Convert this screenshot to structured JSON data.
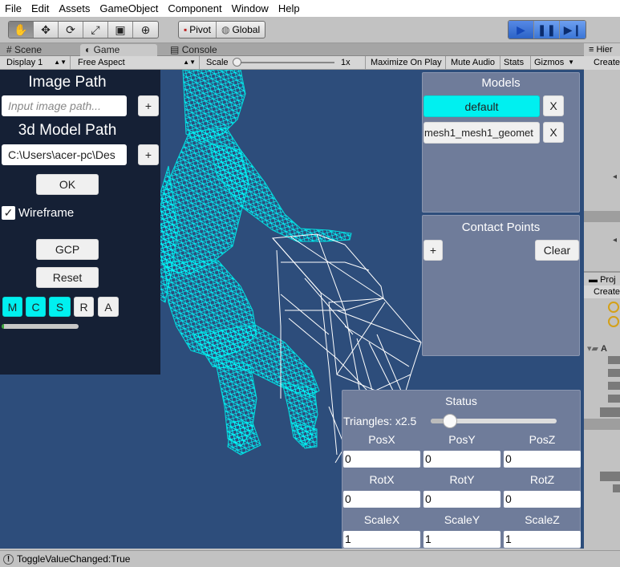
{
  "menu": [
    "File",
    "Edit",
    "Assets",
    "GameObject",
    "Component",
    "Window",
    "Help"
  ],
  "toolbar": {
    "tools": [
      "hand-icon",
      "move-icon",
      "rotate-icon",
      "scale-icon",
      "rect-icon",
      "transform-icon"
    ],
    "pivot_label": "Pivot",
    "global_label": "Global"
  },
  "tabs": [
    "Scene",
    "Game",
    "Console"
  ],
  "gamebar": {
    "display": "Display 1",
    "aspect": "Free Aspect",
    "scale_label": "Scale",
    "scale_value": "1x",
    "maximize": "Maximize On Play",
    "mute": "Mute Audio",
    "stats": "Stats",
    "gizmos": "Gizmos"
  },
  "hierarchy": {
    "tab": "Hier",
    "create": "Create"
  },
  "project": {
    "tab": "Proj",
    "create": "Create",
    "folder": "A"
  },
  "left_panel": {
    "image_title": "Image Path",
    "image_placeholder": "Input image path...",
    "model_title": "3d Model Path",
    "model_value": "C:\\Users\\acer-pc\\Des",
    "add_label": "+",
    "ok_label": "OK",
    "wireframe_label": "Wireframe",
    "wireframe_checked": "✓",
    "gcp_label": "GCP",
    "reset_label": "Reset",
    "mode_buttons": [
      "M",
      "C",
      "S",
      "R",
      "A"
    ],
    "progress": 0.03
  },
  "models": {
    "title": "Models",
    "items": [
      {
        "name": "default",
        "remove": "X"
      },
      {
        "name": "mesh1_mesh1_geomet",
        "remove": "X"
      }
    ]
  },
  "contact_points": {
    "title": "Contact Points",
    "add": "+",
    "clear": "Clear"
  },
  "status": {
    "title": "Status",
    "triangles_label": "Triangles: x2.5",
    "triangles_slider": 0.15,
    "pos_labels": [
      "PosX",
      "PosY",
      "PosZ"
    ],
    "pos_values": [
      "0",
      "0",
      "0"
    ],
    "rot_labels": [
      "RotX",
      "RotY",
      "RotZ"
    ],
    "rot_values": [
      "0",
      "0",
      "0"
    ],
    "scale_labels": [
      "ScaleX",
      "ScaleY",
      "ScaleZ"
    ],
    "scale_values": [
      "1",
      "1",
      "1"
    ]
  },
  "console_message": "ToggleValueChanged:True",
  "colors": {
    "game_bg": "#2d4d7b",
    "mesh": "#00ffff",
    "left_panel": "#152035",
    "right_panel": "#6f7c9a",
    "accent_cyan": "#00f0f0"
  }
}
